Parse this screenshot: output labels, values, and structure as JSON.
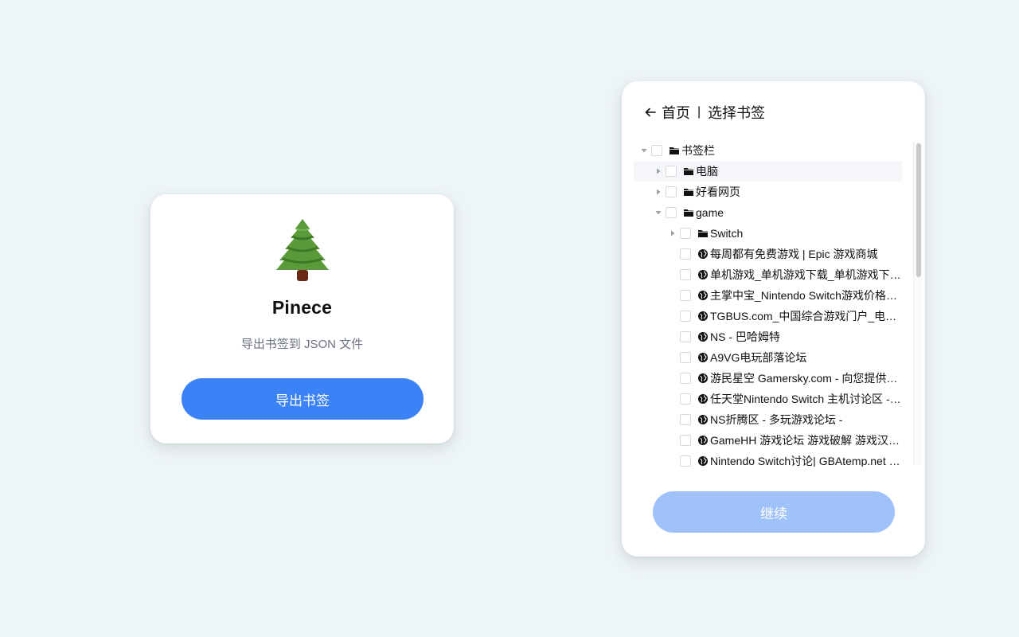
{
  "home": {
    "app_name": "Pinece",
    "subtitle": "导出书签到 JSON 文件",
    "export_button": "导出书签"
  },
  "select": {
    "breadcrumb_home": "首页",
    "breadcrumb_sep": "|",
    "breadcrumb_current": "选择书签",
    "continue_button": "继续",
    "tree": [
      {
        "label": "书签栏",
        "type": "folder",
        "depth": 0,
        "caret": "down"
      },
      {
        "label": "电脑",
        "type": "folder",
        "depth": 1,
        "caret": "right",
        "hover": true
      },
      {
        "label": "好看网页",
        "type": "folder",
        "depth": 1,
        "caret": "right"
      },
      {
        "label": "game",
        "type": "folder",
        "depth": 1,
        "caret": "down"
      },
      {
        "label": "Switch",
        "type": "folder",
        "depth": 2,
        "caret": "right"
      },
      {
        "label": "每周都有免费游戏 | Epic 游戏商城",
        "type": "link",
        "depth": 2
      },
      {
        "label": "单机游戏_单机游戏下载_单机游戏下载基地",
        "type": "link",
        "depth": 2
      },
      {
        "label": "主掌中宝_Nintendo Switch游戏价格比较",
        "type": "link",
        "depth": 2
      },
      {
        "label": "TGBUS.com_中国综合游戏门户_电玩巴士",
        "type": "link",
        "depth": 2
      },
      {
        "label": "NS - 巴哈姆特",
        "type": "link",
        "depth": 2
      },
      {
        "label": "A9VG电玩部落论坛",
        "type": "link",
        "depth": 2
      },
      {
        "label": "游民星空 Gamersky.com - 向您提供最新游戏资讯",
        "type": "link",
        "depth": 2
      },
      {
        "label": "任天堂Nintendo Switch 主机讨论区 - 论坛",
        "type": "link",
        "depth": 2
      },
      {
        "label": "NS折腾区 - 多玩游戏论坛 -",
        "type": "link",
        "depth": 2
      },
      {
        "label": "GameHH 游戏论坛 游戏破解 游戏汉化 游戏下载",
        "type": "link",
        "depth": 2
      },
      {
        "label": "Nintendo Switch讨论| GBAtemp.net - The Independent Video Game Community",
        "type": "link",
        "depth": 2
      }
    ]
  },
  "colors": {
    "background": "#eef5f8",
    "primary": "#3b82f6",
    "primary_disabled": "#9fc2fb",
    "muted_text": "#6b7280"
  },
  "icons": {
    "tree": "pine-tree-icon",
    "back": "arrow-left-icon",
    "folder": "folder-icon",
    "link": "globe-icon",
    "caret_right": "caret-right-icon",
    "caret_down": "caret-down-icon"
  }
}
